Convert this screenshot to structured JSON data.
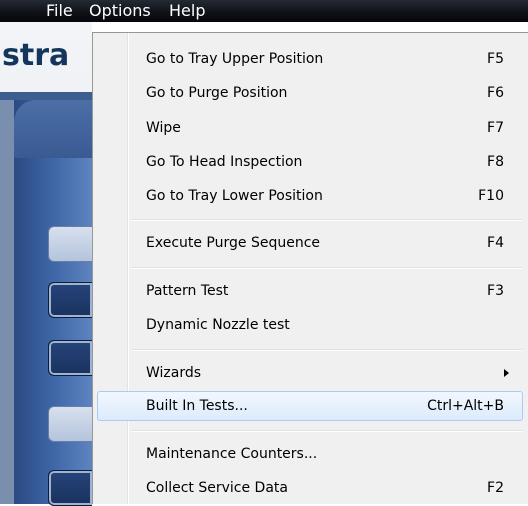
{
  "menubar": {
    "items": [
      "File",
      "Options",
      "Help"
    ]
  },
  "app": {
    "logo_text": "stra"
  },
  "options_menu": {
    "items": [
      {
        "label": "Go to Tray Upper Position",
        "shortcut": "F5"
      },
      {
        "label": "Go to Purge Position",
        "shortcut": "F6"
      },
      {
        "label": "Wipe",
        "shortcut": "F7"
      },
      {
        "label": "Go To Head Inspection",
        "shortcut": "F8"
      },
      {
        "label": "Go to Tray Lower Position",
        "shortcut": "F10"
      },
      {
        "label": "Execute Purge Sequence",
        "shortcut": "F4"
      },
      {
        "label": "Pattern Test",
        "shortcut": "F3"
      },
      {
        "label": "Dynamic Nozzle test",
        "shortcut": ""
      },
      {
        "label": "Wizards",
        "shortcut": "",
        "submenu_icon": "triangle-right-icon"
      },
      {
        "label": "Built In Tests...",
        "shortcut": "Ctrl+Alt+B",
        "highlighted": true
      },
      {
        "label": "Maintenance Counters...",
        "shortcut": ""
      },
      {
        "label": "Collect Service Data",
        "shortcut": "F2"
      }
    ]
  },
  "colors": {
    "menubar_bg": "#0d1016",
    "menu_bg": "#f0f0f0",
    "highlight_bg": "#dcebfc",
    "highlight_border": "#a8cdf1",
    "panel_blue": "#3a5a92"
  }
}
